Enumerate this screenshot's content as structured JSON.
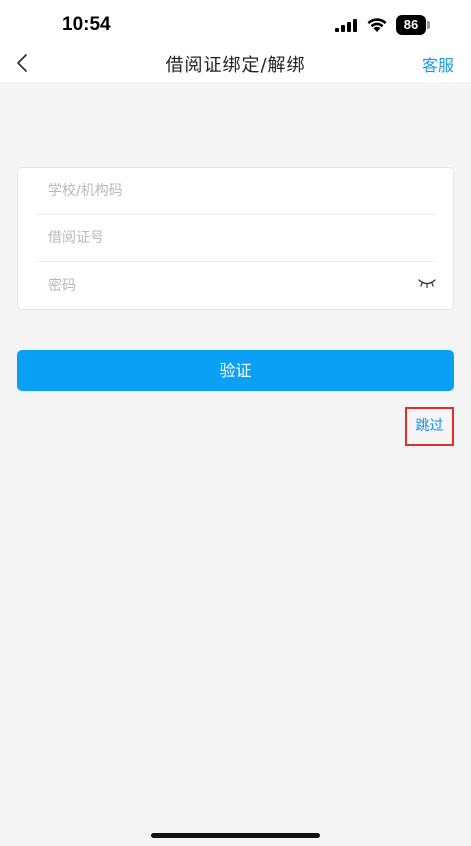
{
  "status_bar": {
    "time": "10:54",
    "battery": "86"
  },
  "nav": {
    "title": "借阅证绑定/解绑",
    "service_label": "客服"
  },
  "form": {
    "school_placeholder": "学校/机构码",
    "card_placeholder": "借阅证号",
    "password_placeholder": "密码"
  },
  "actions": {
    "verify_label": "验证",
    "skip_label": "跳过"
  },
  "colors": {
    "accent": "#0aa0f5",
    "link": "#1a9be6",
    "highlight_border": "#e0302a",
    "background": "#f5f5f5"
  },
  "icons": [
    "signal-icon",
    "wifi-icon",
    "battery-icon",
    "back-icon",
    "eye-closed-icon"
  ]
}
